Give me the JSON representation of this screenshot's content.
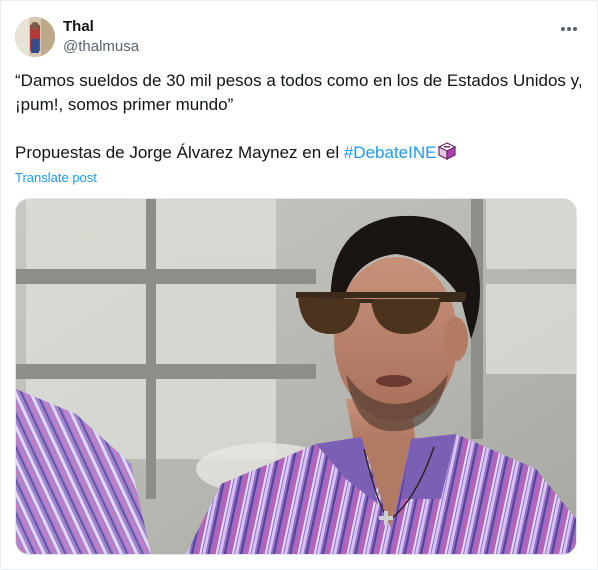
{
  "author": {
    "display_name": "Thal",
    "handle": "@thalmusa"
  },
  "tweet": {
    "line1": "“Damos sueldos de 30 mil pesos a todos como en los de Estados Unidos y, ¡pum!, somos primer mundo”",
    "line2_prefix": "Propuestas de Jorge Álvarez Maynez en el ",
    "hashtag": "#DebateINE",
    "translate_label": "Translate post"
  },
  "icons": {
    "more": "more-dots-icon",
    "ballot": "ballot-box-icon"
  },
  "colors": {
    "link": "#1d9bf0",
    "secondary_text": "#536471"
  }
}
